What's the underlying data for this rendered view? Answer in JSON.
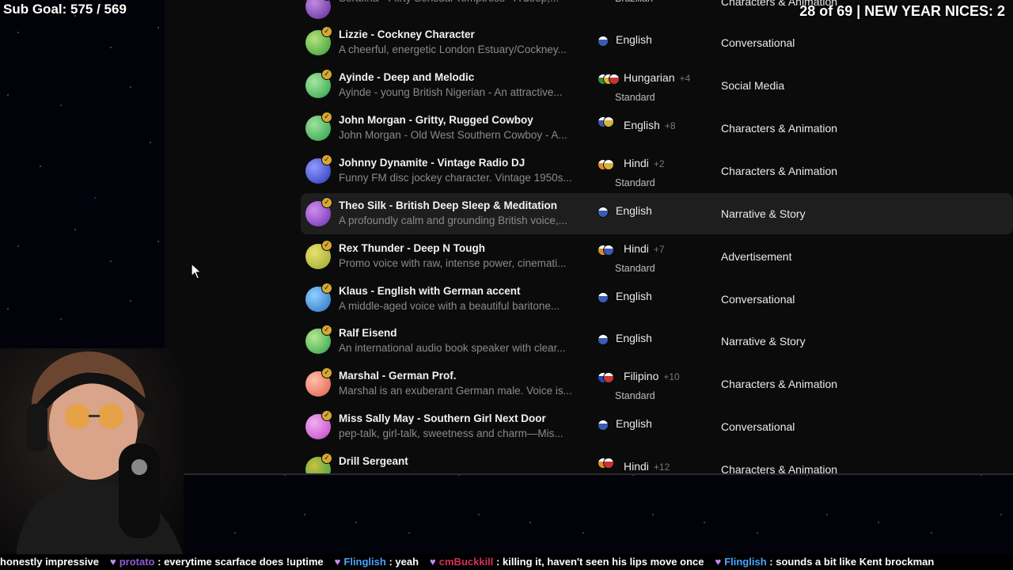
{
  "overlay": {
    "sub_goal": "Sub Goal: 575 / 569",
    "nices": "28 of 69 | NEW YEAR NICES: 2"
  },
  "voices": [
    {
      "name": "",
      "description": "Serafina - Flirty Sensual Temptress - A deep,...",
      "language": "",
      "extra": "",
      "standard": "Brazilian",
      "category": "Characters & Animation",
      "avatar_colors": [
        "#5b2a9c",
        "#c28be0"
      ],
      "flags": [
        "#1a9a3a"
      ],
      "highlight": false
    },
    {
      "name": "Lizzie - Cockney Character",
      "description": "A cheerful, energetic London Estuary/Cockney...",
      "language": "English",
      "extra": "",
      "standard": "",
      "category": "Conversational",
      "avatar_colors": [
        "#2e9e3a",
        "#b8e07a"
      ],
      "flags": [
        "#3b5bb5"
      ],
      "highlight": false
    },
    {
      "name": "Ayinde - Deep and Melodic",
      "description": "Ayinde - young British Nigerian - An attractive...",
      "language": "Hungarian",
      "extra": "+4",
      "standard": "Standard",
      "category": "Social Media",
      "avatar_colors": [
        "#27a04a",
        "#a8e6a0"
      ],
      "flags": [
        "#3c8d3c",
        "#d6b33a",
        "#c8342f"
      ],
      "highlight": false
    },
    {
      "name": "John Morgan - Gritty, Rugged Cowboy",
      "description": "John Morgan - Old West Southern Cowboy - A...",
      "language": "English",
      "extra": "+8",
      "standard": "",
      "category": "Characters & Animation",
      "avatar_colors": [
        "#27a04a",
        "#9fe09a"
      ],
      "flags": [
        "#3b5bb5",
        "#d6b33a"
      ],
      "highlight": false
    },
    {
      "name": "Johnny Dynamite - Vintage Radio DJ",
      "description": "Funny FM disc jockey character. Vintage 1950s...",
      "language": "Hindi",
      "extra": "+2",
      "standard": "Standard",
      "category": "Characters & Animation",
      "avatar_colors": [
        "#2a36b8",
        "#8f9bff"
      ],
      "flags": [
        "#e28b2b",
        "#d6b33a"
      ],
      "highlight": false
    },
    {
      "name": "Theo Silk - British Deep Sleep & Meditation",
      "description": "A profoundly calm and grounding British voice,...",
      "language": "English",
      "extra": "",
      "standard": "",
      "category": "Narrative & Story",
      "avatar_colors": [
        "#6a2fb0",
        "#d28cf0"
      ],
      "flags": [
        "#3b5bb5"
      ],
      "highlight": true
    },
    {
      "name": "Rex Thunder - Deep N Tough",
      "description": "Promo voice with raw, intense power, cinemati...",
      "language": "Hindi",
      "extra": "+7",
      "standard": "Standard",
      "category": "Advertisement",
      "avatar_colors": [
        "#9aa62a",
        "#e8e070"
      ],
      "flags": [
        "#e28b2b",
        "#3b5bb5"
      ],
      "highlight": false
    },
    {
      "name": "Klaus - English with German accent",
      "description": "A middle-aged voice with a beautiful baritone...",
      "language": "English",
      "extra": "",
      "standard": "",
      "category": "Conversational",
      "avatar_colors": [
        "#2a6fc2",
        "#8fd0ff"
      ],
      "flags": [
        "#3b5bb5"
      ],
      "highlight": false
    },
    {
      "name": "Ralf Eisend",
      "description": "An international audio book speaker with clear...",
      "language": "English",
      "extra": "",
      "standard": "",
      "category": "Narrative & Story",
      "avatar_colors": [
        "#27a04a",
        "#b8e890"
      ],
      "flags": [
        "#3b5bb5"
      ],
      "highlight": false
    },
    {
      "name": "Marshal - German Prof.",
      "description": "Marshal is an exuberant German male. Voice is...",
      "language": "Filipino",
      "extra": "+10",
      "standard": "Standard",
      "category": "Characters & Animation",
      "avatar_colors": [
        "#e05a4a",
        "#ffc0a8"
      ],
      "flags": [
        "#2a44b0",
        "#c8342f"
      ],
      "highlight": false
    },
    {
      "name": "Miss Sally May - Southern Girl Next Door",
      "description": "pep-talk, girl-talk, sweetness and charm—Mis...",
      "language": "English",
      "extra": "",
      "standard": "",
      "category": "Conversational",
      "avatar_colors": [
        "#c040c8",
        "#f0b0f0"
      ],
      "flags": [
        "#3b5bb5"
      ],
      "highlight": false
    },
    {
      "name": "Drill Sergeant",
      "description": "",
      "language": "Hindi",
      "extra": "+12",
      "standard": "",
      "category": "Characters & Animation",
      "avatar_colors": [
        "#27a04a",
        "#d0c040"
      ],
      "flags": [
        "#e28b2b",
        "#c8342f"
      ],
      "highlight": false
    }
  ],
  "ticker": [
    {
      "user": "",
      "text": "honestly impressive",
      "user_class": ""
    },
    {
      "user": "protato",
      "text": ": everytime scarface does !uptime",
      "user_class": "user-purple"
    },
    {
      "user": "Flinglish",
      "text": ": yeah",
      "user_class": "user-blue"
    },
    {
      "user": "cmBuckkill",
      "text": ": killing it, haven't seen his lips move once",
      "user_class": "user-red"
    },
    {
      "user": "Flinglish",
      "text": ": sounds a bit like Kent brockman",
      "user_class": "user-blue"
    }
  ]
}
